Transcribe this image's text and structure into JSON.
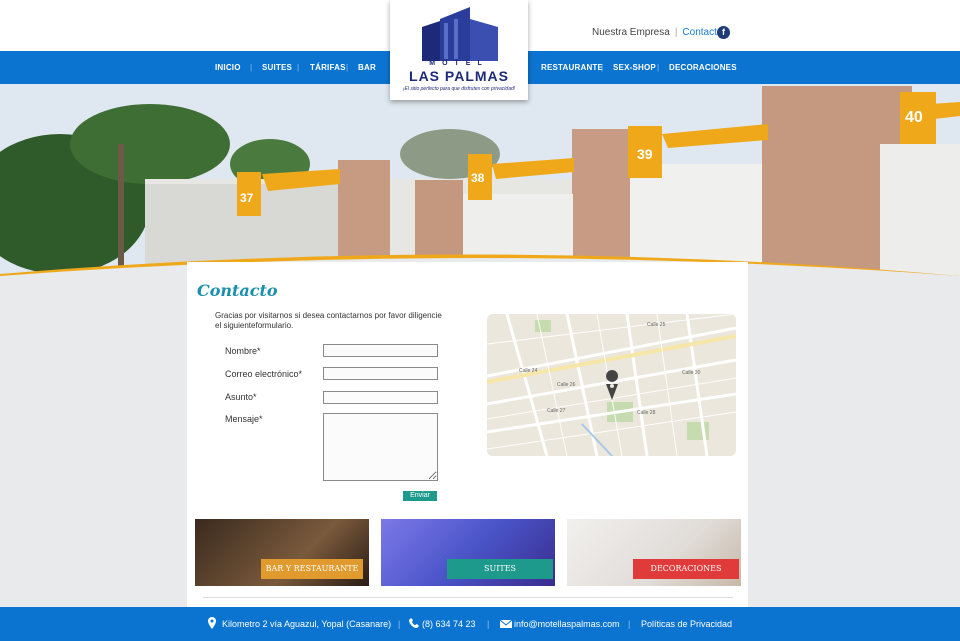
{
  "toplinks": {
    "empresa": "Nuestra Empresa",
    "contacto": "Contacto",
    "facebook_glyph": "f",
    "separator": "|"
  },
  "nav": {
    "inicio": "INICIO",
    "suites": "SUITES",
    "tarifas": "TÁRIFAS",
    "bar": "BAR",
    "restaurante": "RESTAURANTE",
    "sexshop": "SEX-SHOP",
    "decoraciones": "DECORACIONES",
    "separator": "|"
  },
  "logo": {
    "motel": "MOTEL",
    "name": "LAS PALMAS",
    "tagline": "¡El sitio perfecto para que disfrutes con privacidad!"
  },
  "hero": {
    "numbers": [
      "37",
      "38",
      "39",
      "40"
    ]
  },
  "contact": {
    "title": "Contacto",
    "intro": "Gracias por visitarnos si desea contactarnos por  favor diligencie el siguienteformulario.",
    "fields": {
      "nombre": "Nombre*",
      "correo": "Correo electrónico*",
      "asunto": "Asunto*",
      "mensaje": "Mensaje*"
    },
    "send": "Enviar"
  },
  "map": {
    "streets": [
      "Calle 24",
      "Calle 25",
      "Calle 26",
      "Calle 27",
      "Calle 28",
      "Calle 30"
    ]
  },
  "tiles": [
    {
      "label": "BAR Y RESTAURANTE",
      "color": "#e09a2e"
    },
    {
      "label": "SUITES",
      "color": "#1e9a8c"
    },
    {
      "label": "DECORACIONES",
      "color": "#e03a3a"
    }
  ],
  "footer": {
    "address": "Kilometro 2 vía Aguazul, Yopal (Casanare)",
    "phone": "(8) 634 74 23",
    "email": "info@motellaspalmas.com",
    "privacy": "Políticas de Privacidad",
    "separator": "|"
  },
  "colors": {
    "nav_blue": "#0b74d0",
    "accent_orange": "#f0a81b",
    "title_teal": "#1a8fae"
  }
}
